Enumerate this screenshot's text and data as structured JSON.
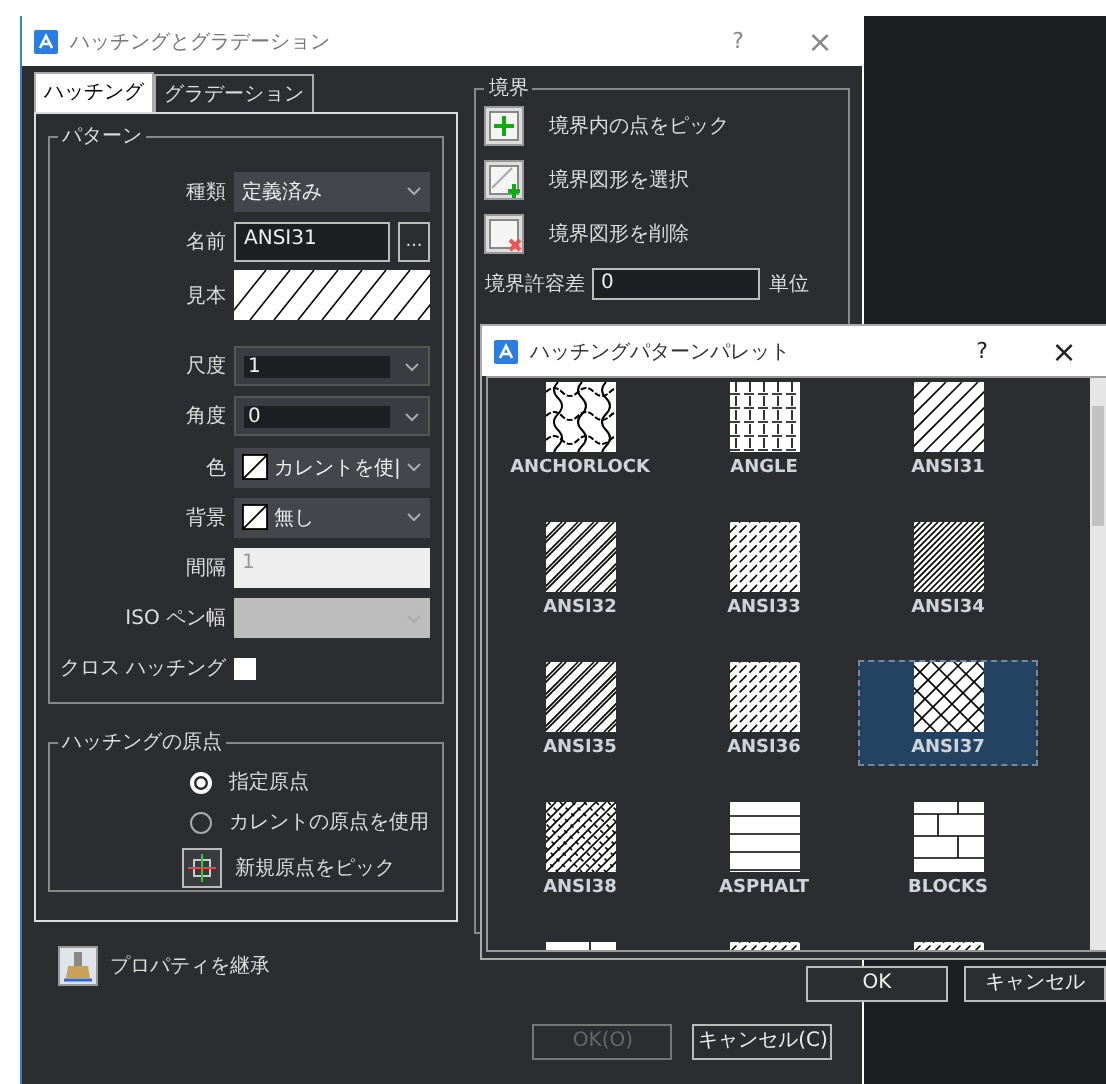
{
  "dialog": {
    "title": "ハッチングとグラデーション",
    "help": "?",
    "close": "×",
    "tabs": [
      {
        "label": "ハッチング",
        "selected": true
      },
      {
        "label": "グラデーション",
        "selected": false
      }
    ],
    "pattern_group": {
      "title": "パターン",
      "rows": [
        {
          "kind": "select",
          "label": "種類",
          "value": "定義済み",
          "disabled": false
        },
        {
          "kind": "browse",
          "label": "名前",
          "value": "ANSI31",
          "button": "..."
        },
        {
          "kind": "preview",
          "label": "見本"
        },
        {
          "kind": "combo",
          "label": "尺度",
          "value": "1",
          "disabled": false
        },
        {
          "kind": "combo",
          "label": "角度",
          "value": "0",
          "disabled": false
        },
        {
          "kind": "color",
          "label": "色",
          "value": "カレントを使|"
        },
        {
          "kind": "color",
          "label": "背景",
          "value": "無し"
        },
        {
          "kind": "input",
          "label": "間隔",
          "value": "1",
          "disabled": true
        },
        {
          "kind": "select",
          "label": "ISO ペン幅",
          "value": "",
          "disabled": true
        },
        {
          "kind": "checkbox",
          "label": "クロス ハッチング",
          "checked": false
        }
      ]
    },
    "origin_group": {
      "title": "ハッチングの原点",
      "radios": [
        {
          "label": "指定原点",
          "selected": true
        },
        {
          "label": "カレントの原点を使用",
          "selected": false
        }
      ],
      "pick": "新規原点をピック"
    },
    "inherit": "プロパティを継承",
    "boundary": {
      "title": "境界",
      "actions": [
        {
          "kind": "pick",
          "label": "境界内の点をピック"
        },
        {
          "kind": "select",
          "label": "境界図形を選択"
        },
        {
          "kind": "remove",
          "label": "境界図形を削除"
        }
      ],
      "tolerance_label": "境界許容差",
      "tolerance": "0",
      "unit": "単位"
    },
    "buttons": [
      {
        "label": "OK(O)",
        "disabled": true
      },
      {
        "label": "キャンセル(C)",
        "disabled": false
      }
    ]
  },
  "palette": {
    "title": "ハッチングパターンパレット",
    "help": "?",
    "close": "×",
    "patterns": [
      {
        "name": "ANCHORLOCK",
        "kind": "wavy",
        "selected": false
      },
      {
        "name": "ANGLE",
        "kind": "grid",
        "selected": false
      },
      {
        "name": "ANSI31",
        "kind": "diagonal",
        "selected": false
      },
      {
        "name": "ANSI32",
        "kind": "diagonal-double",
        "selected": false
      },
      {
        "name": "ANSI33",
        "kind": "diagonal-dashed",
        "selected": false
      },
      {
        "name": "ANSI34",
        "kind": "diagonal-dense",
        "selected": false
      },
      {
        "name": "ANSI35",
        "kind": "diagonal-double",
        "selected": false
      },
      {
        "name": "ANSI36",
        "kind": "diagonal-dashed",
        "selected": false
      },
      {
        "name": "ANSI37",
        "kind": "crosshatch",
        "selected": true
      },
      {
        "name": "ANSI38",
        "kind": "crosshatch-dense",
        "selected": false
      },
      {
        "name": "ASPHALT",
        "kind": "asphalt",
        "selected": false
      },
      {
        "name": "BLOCKS",
        "kind": "bricks",
        "selected": false
      },
      {
        "kind": "bricks",
        "selected": false
      },
      {
        "kind": "diagonal-dashed",
        "selected": false
      },
      {
        "kind": "diagonal-dashed",
        "selected": false
      }
    ],
    "buttons": [
      "OK",
      "キャンセル"
    ]
  }
}
